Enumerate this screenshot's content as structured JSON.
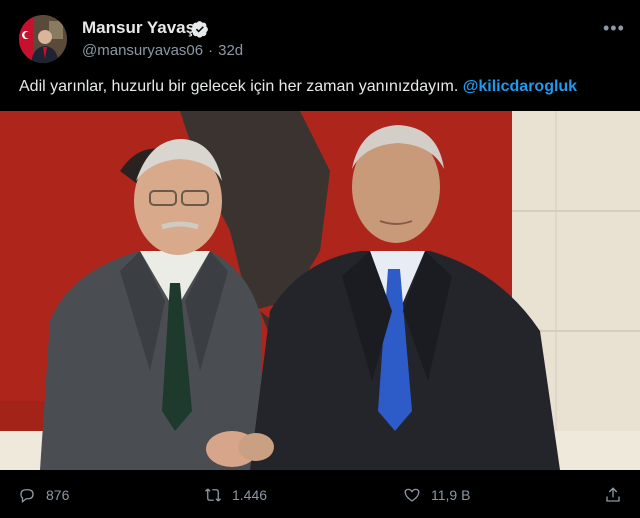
{
  "tweet": {
    "author_name": "Mansur Yavaş",
    "handle": "@mansuryavas06",
    "separator": "·",
    "time": "32d",
    "text": "Adil yarınlar, huzurlu bir gelecek için her zaman yanınızdayım.",
    "mention": "@kilicdarogluk"
  },
  "actions": {
    "replies": "876",
    "retweets": "1.446",
    "likes": "11,9 B"
  },
  "icons": {
    "more": "more-horizontal-icon",
    "reply": "reply-icon",
    "retweet": "retweet-icon",
    "like": "heart-icon",
    "share": "share-icon",
    "verified": "verified-badge-icon"
  },
  "colors": {
    "background": "#000000",
    "accent": "#1d9bf0",
    "secondary_text": "#8b98a5",
    "primary_text": "#e7e9ea"
  }
}
